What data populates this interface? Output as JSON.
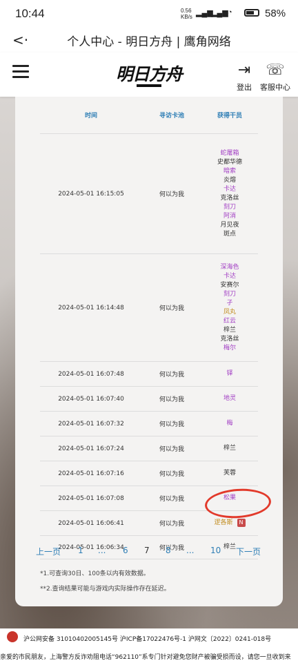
{
  "status_bar": {
    "time": "10:44",
    "net_speed_top": "0.56",
    "net_speed_bottom": "KB/s",
    "battery": "58"
  },
  "title_bar": {
    "title": "个人中心 - 明日方舟 | 鹰角网络"
  },
  "header": {
    "logo_text": "明日方舟",
    "logout_label": "登出",
    "service_label": "客服中心"
  },
  "table": {
    "headers": [
      "时间",
      "寻访卡池",
      "获得干员"
    ],
    "rows": [
      {
        "time": "2024-05-01 16:15:05",
        "pool": "何以为我",
        "operators": [
          {
            "name": "蛇屠箱",
            "color": "purple"
          },
          {
            "name": "史都华德",
            "color": "black"
          },
          {
            "name": "暗索",
            "color": "purple"
          },
          {
            "name": "炎熔",
            "color": "black"
          },
          {
            "name": "卡达",
            "color": "purple"
          },
          {
            "name": "克洛丝",
            "color": "black"
          },
          {
            "name": "刻刀",
            "color": "purple"
          },
          {
            "name": "阿消",
            "color": "purple"
          },
          {
            "name": "月见夜",
            "color": "black"
          },
          {
            "name": "斑点",
            "color": "black"
          }
        ]
      },
      {
        "time": "2024-05-01 16:14:48",
        "pool": "何以为我",
        "operators": [
          {
            "name": "深海色",
            "color": "purple"
          },
          {
            "name": "卡达",
            "color": "purple"
          },
          {
            "name": "安赛尔",
            "color": "black"
          },
          {
            "name": "刻刀",
            "color": "purple"
          },
          {
            "name": "孑",
            "color": "purple"
          },
          {
            "name": "凤丸",
            "color": "gold"
          },
          {
            "name": "红云",
            "color": "purple"
          },
          {
            "name": "梓兰",
            "color": "black"
          },
          {
            "name": "克洛丝",
            "color": "black"
          },
          {
            "name": "梅尔",
            "color": "purple"
          }
        ]
      },
      {
        "time": "2024-05-01 16:07:48",
        "pool": "何以为我",
        "operators": [
          {
            "name": "铎",
            "color": "purple"
          }
        ]
      },
      {
        "time": "2024-05-01 16:07:40",
        "pool": "何以为我",
        "operators": [
          {
            "name": "地灵",
            "color": "purple"
          }
        ]
      },
      {
        "time": "2024-05-01 16:07:32",
        "pool": "何以为我",
        "operators": [
          {
            "name": "梅",
            "color": "purple"
          }
        ]
      },
      {
        "time": "2024-05-01 16:07:24",
        "pool": "何以为我",
        "operators": [
          {
            "name": "梓兰",
            "color": "black"
          }
        ]
      },
      {
        "time": "2024-05-01 16:07:16",
        "pool": "何以为我",
        "operators": [
          {
            "name": "芙蓉",
            "color": "black"
          }
        ]
      },
      {
        "time": "2024-05-01 16:07:08",
        "pool": "何以为我",
        "operators": [
          {
            "name": "松果",
            "color": "purple"
          }
        ]
      },
      {
        "time": "2024-05-01 16:06:41",
        "pool": "何以为我",
        "operators": [
          {
            "name": "逻各斯",
            "color": "gold",
            "badge": "N"
          }
        ]
      },
      {
        "time": "2024-05-01 16:06:34",
        "pool": "何以为我",
        "operators": [
          {
            "name": "梓兰",
            "color": "black"
          }
        ]
      }
    ]
  },
  "pager": {
    "prev": "上一页",
    "p1": "1",
    "ellipsis1": "...",
    "p6": "6",
    "p7": "7",
    "p8": "8",
    "ellipsis2": "...",
    "p10": "10",
    "next": "下一页"
  },
  "notes": {
    "note1": "*1.可查询30日、100条以内有效数据。",
    "note2": "**2.查询结果可能与游戏内实际操作存在延迟。"
  },
  "footer": {
    "line1": "沪公网安备 31010402005145号  沪ICP备17022476号-1  沪网文〔2022〕0241-018号",
    "line2": "亲爱的市民朋友，上海警方反诈劝阻电话“962110”系专门针对避免您财产被骗受损而设，请您一旦收到来"
  },
  "colors": {
    "link": "#2e7eb5",
    "purple": "#a23fc4",
    "gold": "#c08a1a",
    "annotation": "#e23a2b"
  }
}
